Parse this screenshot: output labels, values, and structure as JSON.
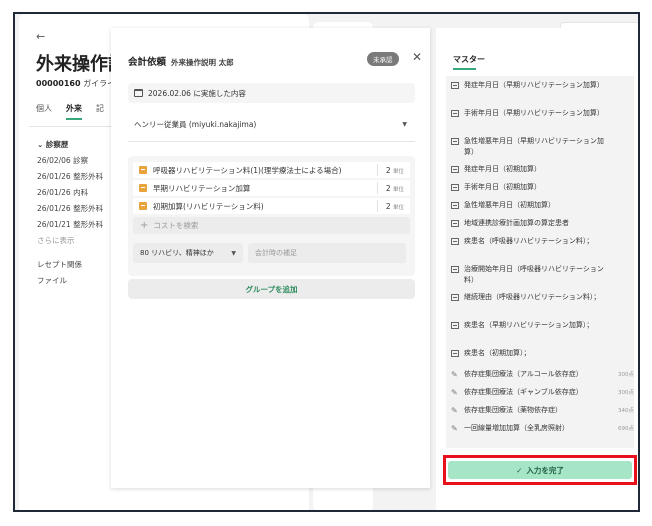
{
  "background": {
    "back_icon": "back-arrow-icon",
    "title": "外来操作説",
    "patient_id": "00000160",
    "patient_name": "ガイライ",
    "tabs": [
      "個人",
      "外来",
      "記"
    ],
    "history_header": "診察歴",
    "history_items": [
      "26/02/06 診察",
      "26/01/26 整形外科",
      "26/01/26 内科",
      "26/01/26 整形外科",
      "26/01/21 整形外科"
    ],
    "show_more": "さらに表示",
    "receipt": "レセプト関係",
    "file": "ファイル"
  },
  "modal": {
    "title": "会計依頼",
    "patient": "外来操作説明 太郎",
    "status_badge": "未承認",
    "close_icon": "close-icon",
    "date_text": "2026.02.06 に実施した内容",
    "staff": "ヘンリー従業員 (miyuki.nakajima)",
    "items": [
      {
        "name": "呼吸器リハビリテーション料(1)(理学療法士による場合)",
        "qty": "2",
        "unit": "単位"
      },
      {
        "name": "早期リハビリテーション加算",
        "qty": "2",
        "unit": "単位"
      },
      {
        "name": "初期加算(リハビリテーション料)",
        "qty": "2",
        "unit": "単位"
      }
    ],
    "cost_search_placeholder": "コストを検索",
    "dept_select": "80 リハビリ、精神ほか",
    "note_placeholder": "会計時の補足",
    "add_group": "グループを追加"
  },
  "master": {
    "tab": "マスター",
    "rows": [
      {
        "icon": "document-icon",
        "label": "発症年月日（早期リハビリテーション加算）",
        "points": ""
      },
      {
        "icon": "document-icon",
        "label": "手術年月日（早期リハビリテーション加算）",
        "points": ""
      },
      {
        "icon": "document-icon",
        "label": "急性増悪年月日（早期リハビリテーション加算）",
        "points": ""
      },
      {
        "icon": "document-icon",
        "label": "発症年月日（初期加算）",
        "points": ""
      },
      {
        "icon": "document-icon",
        "label": "手術年月日（初期加算）",
        "points": ""
      },
      {
        "icon": "document-icon",
        "label": "急性増悪年月日（初期加算）",
        "points": ""
      },
      {
        "icon": "document-icon",
        "label": "地域連携診療計画加算の算定患者",
        "points": ""
      },
      {
        "icon": "document-icon",
        "label": "疾患名（呼吸器リハビリテーション料）；",
        "points": ""
      },
      {
        "icon": "document-icon",
        "label": "治療開始年月日（呼吸器リハビリテーション料）",
        "points": ""
      },
      {
        "icon": "document-icon",
        "label": "継続理由（呼吸器リハビリテーション料）；",
        "points": ""
      },
      {
        "icon": "document-icon",
        "label": "疾患名（早期リハビリテーション加算）；",
        "points": ""
      },
      {
        "icon": "document-icon",
        "label": "疾患名（初期加算）；",
        "points": ""
      },
      {
        "icon": "procedure-icon",
        "label": "依存症集団療法（アルコール依存症）",
        "points": "300点"
      },
      {
        "icon": "procedure-icon",
        "label": "依存症集団療法（ギャンブル依存症）",
        "points": "300点"
      },
      {
        "icon": "procedure-icon",
        "label": "依存症集団療法（薬物依存症）",
        "points": "340点"
      },
      {
        "icon": "procedure-icon",
        "label": "一回線量増加加算（全乳房照射）",
        "points": "690点"
      }
    ],
    "complete_button": "入力を完了"
  }
}
